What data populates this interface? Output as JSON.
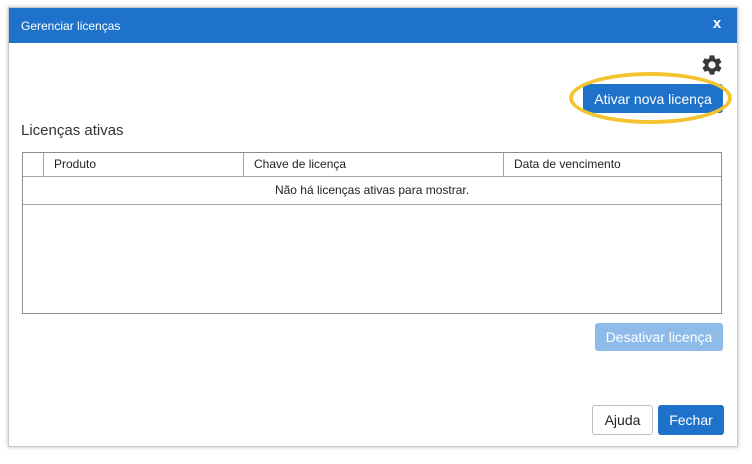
{
  "dialog": {
    "title": "Gerenciar licenças",
    "close_glyph": "x"
  },
  "toolbar": {
    "settings_icon": "gear-icon",
    "activate_label": "Ativar nova licença"
  },
  "licenses": {
    "section_title": "Licenças ativas",
    "columns": [
      "Produto",
      "Chave de licença",
      "Data de vencimento"
    ],
    "empty_message": "Não há licenças ativas para mostrar."
  },
  "actions": {
    "deactivate_label": "Desativar licença",
    "deactivate_enabled": false
  },
  "footer": {
    "help_label": "Ajuda",
    "close_label": "Fechar"
  },
  "colors": {
    "titlebar": "#1f72c9",
    "primary_button": "#1f72c9",
    "disabled_button": "#8ebbe7",
    "highlight": "#f4c430"
  }
}
